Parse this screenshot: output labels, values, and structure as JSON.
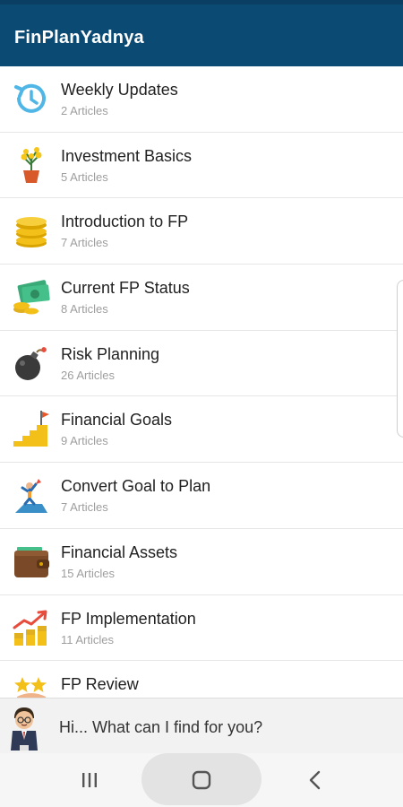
{
  "app": {
    "title": "FinPlanYadnya"
  },
  "categories": [
    {
      "title": "Weekly Updates",
      "count": "2 Articles",
      "icon": "clock-refresh-icon"
    },
    {
      "title": "Investment Basics",
      "count": "5 Articles",
      "icon": "money-plant-icon"
    },
    {
      "title": "Introduction to FP",
      "count": "7 Articles",
      "icon": "coin-stack-icon"
    },
    {
      "title": "Current FP Status",
      "count": "8 Articles",
      "icon": "cash-coins-icon"
    },
    {
      "title": "Risk Planning",
      "count": "26 Articles",
      "icon": "bomb-icon"
    },
    {
      "title": "Financial Goals",
      "count": "9 Articles",
      "icon": "stairs-flag-icon"
    },
    {
      "title": "Convert Goal to Plan",
      "count": "7 Articles",
      "icon": "person-summit-icon"
    },
    {
      "title": "Financial Assets",
      "count": "15 Articles",
      "icon": "wallet-icon"
    },
    {
      "title": "FP Implementation",
      "count": "11 Articles",
      "icon": "growth-chart-icon"
    },
    {
      "title": "FP Review",
      "count": "",
      "icon": "stars-review-icon"
    }
  ],
  "chat": {
    "prompt": "Hi... What can I find for you?",
    "avatar_icon": "assistant-avatar-icon"
  },
  "nav": {
    "recents_icon": "recents-icon",
    "home_icon": "home-icon",
    "back_icon": "back-icon"
  },
  "colors": {
    "app_bar": "#0b4a73",
    "title_text": "#212121",
    "subtitle_text": "#9e9e9e"
  }
}
